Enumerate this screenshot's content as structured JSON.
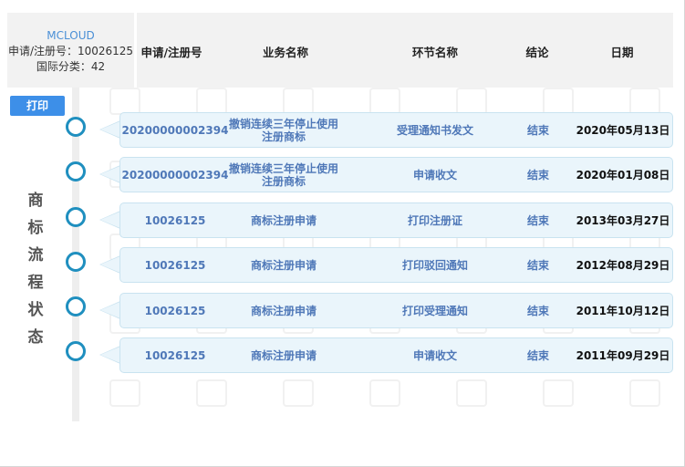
{
  "header": {
    "brand": "MCLOUD",
    "reg_label": "申请/注册号：10026125",
    "class_label": "国际分类：42"
  },
  "columns": [
    "申请/注册号",
    "业务名称",
    "环节名称",
    "结论",
    "日期"
  ],
  "toolbar": {
    "print_label": "打印"
  },
  "timeline": {
    "title_chars": [
      "商",
      "标",
      "流",
      "程",
      "状",
      "态"
    ]
  },
  "rows": [
    {
      "reg_no": "20200000002394",
      "business": "撤销连续三年停止使用注册商标",
      "step": "受理通知书发文",
      "result": "结束",
      "date": "2020年05月13日"
    },
    {
      "reg_no": "20200000002394",
      "business": "撤销连续三年停止使用注册商标",
      "step": "申请收文",
      "result": "结束",
      "date": "2020年01月08日"
    },
    {
      "reg_no": "10026125",
      "business": "商标注册申请",
      "step": "打印注册证",
      "result": "结束",
      "date": "2013年03月27日"
    },
    {
      "reg_no": "10026125",
      "business": "商标注册申请",
      "step": "打印驳回通知",
      "result": "结束",
      "date": "2012年08月29日"
    },
    {
      "reg_no": "10026125",
      "business": "商标注册申请",
      "step": "打印受理通知",
      "result": "结束",
      "date": "2011年10月12日"
    },
    {
      "reg_no": "10026125",
      "business": "商标注册申请",
      "step": "申请收文",
      "result": "结束",
      "date": "2011年09月29日"
    }
  ]
}
